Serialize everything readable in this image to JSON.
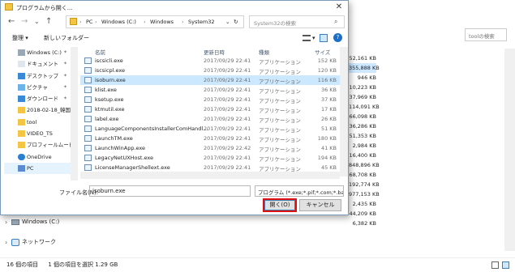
{
  "background": {
    "search_placeholder": "toolの検索",
    "sizes": [
      "52,161 KB",
      "355,888 KB",
      "946 KB",
      "10,223 KB",
      "37,969 KB",
      "114,091 KB",
      "66,098 KB",
      "36,286 KB",
      "51,353 KB",
      "2,984 KB",
      "16,400 KB",
      "848,896 KB",
      "68,708 KB",
      "192,774 KB",
      "977,153 KB",
      "2,435 KB",
      "44,209 KB",
      "6,382 KB"
    ],
    "selected_size_index": 1,
    "nav": [
      {
        "label": "Windows (C:)"
      },
      {
        "label": "ネットワーク"
      }
    ],
    "status": {
      "count": "16 個の項目",
      "selection": "1 個の項目を選択 1.29 GB"
    }
  },
  "dialog": {
    "title": "プログラムから開く...",
    "path": [
      "PC",
      "Windows (C:)",
      "Windows",
      "System32"
    ],
    "search_placeholder": "System32の検索",
    "toolbar": {
      "organize": "整理 ▾",
      "new_folder": "新しいフォルダー"
    },
    "nav_items": [
      {
        "label": "Windows (C:)",
        "pinned": true,
        "icon": "drive-icon",
        "selected": false
      },
      {
        "label": "ドキュメント",
        "pinned": true,
        "icon": "documents-icon",
        "selected": false
      },
      {
        "label": "デスクトップ",
        "pinned": true,
        "icon": "desktop-icon",
        "selected": false
      },
      {
        "label": "ピクチャ",
        "pinned": true,
        "icon": "pictures-icon",
        "selected": false
      },
      {
        "label": "ダウンロード",
        "pinned": true,
        "icon": "download-icon",
        "selected": false
      },
      {
        "label": "2018-02-18_韓国",
        "pinned": false,
        "icon": "folder-icon",
        "selected": false
      },
      {
        "label": "tool",
        "pinned": false,
        "icon": "folder-icon",
        "selected": false
      },
      {
        "label": "VIDEO_TS",
        "pinned": false,
        "icon": "folder-icon",
        "selected": false
      },
      {
        "label": "プロフィールムービー",
        "pinned": false,
        "icon": "folder-icon",
        "selected": false
      },
      {
        "label": "OneDrive",
        "pinned": false,
        "icon": "onedrive-icon",
        "selected": false
      },
      {
        "label": "PC",
        "pinned": false,
        "icon": "pc-icon",
        "selected": true
      }
    ],
    "columns": {
      "name": "名前",
      "date": "更新日時",
      "type": "種類",
      "size": "サイズ"
    },
    "files": [
      {
        "name": "iscsicli.exe",
        "date": "2017/09/29 22:41",
        "type": "アプリケーション",
        "size": "152 KB",
        "selected": false
      },
      {
        "name": "iscsicpl.exe",
        "date": "2017/09/29 22:41",
        "type": "アプリケーション",
        "size": "120 KB",
        "selected": false
      },
      {
        "name": "isoburn.exe",
        "date": "2017/09/29 22:41",
        "type": "アプリケーション",
        "size": "116 KB",
        "selected": true
      },
      {
        "name": "klist.exe",
        "date": "2017/09/29 22:41",
        "type": "アプリケーション",
        "size": "36 KB",
        "selected": false
      },
      {
        "name": "ksetup.exe",
        "date": "2017/09/29 22:41",
        "type": "アプリケーション",
        "size": "37 KB",
        "selected": false
      },
      {
        "name": "ktmutil.exe",
        "date": "2017/09/29 22:41",
        "type": "アプリケーション",
        "size": "17 KB",
        "selected": false
      },
      {
        "name": "label.exe",
        "date": "2017/09/29 22:41",
        "type": "アプリケーション",
        "size": "26 KB",
        "selected": false
      },
      {
        "name": "LanguageComponentsInstallerComHandl...",
        "date": "2017/09/29 22:41",
        "type": "アプリケーション",
        "size": "51 KB",
        "selected": false
      },
      {
        "name": "LaunchTM.exe",
        "date": "2017/09/29 22:41",
        "type": "アプリケーション",
        "size": "180 KB",
        "selected": false
      },
      {
        "name": "LaunchWinApp.exe",
        "date": "2017/09/29 22:42",
        "type": "アプリケーション",
        "size": "41 KB",
        "selected": false
      },
      {
        "name": "LegacyNetUXHost.exe",
        "date": "2017/09/29 22:41",
        "type": "アプリケーション",
        "size": "194 KB",
        "selected": false
      },
      {
        "name": "LicenseManagerShellext.exe",
        "date": "2017/09/29 22:41",
        "type": "アプリケーション",
        "size": "45 KB",
        "selected": false
      }
    ],
    "filename_label": "ファイル名(N):",
    "filename_value": "isoburn.exe",
    "filetype_value": "プログラム (*.exe;*.pif;*.com;*.bat;",
    "open_label": "開く(O)",
    "cancel_label": "キャンセル"
  }
}
